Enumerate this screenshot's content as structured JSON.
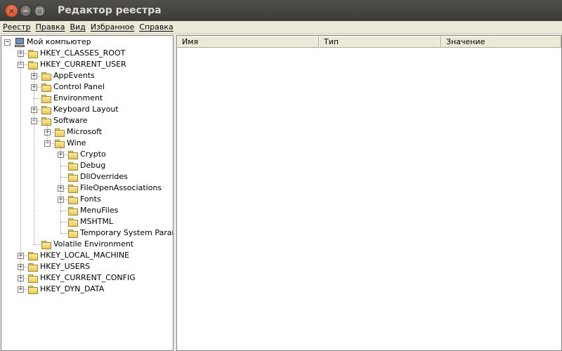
{
  "window": {
    "title": "Редактор реестра",
    "buttons": {
      "close": "×",
      "minimize": "−",
      "maximize": "□"
    }
  },
  "menu": [
    "Реестр",
    "Правка",
    "Вид",
    "Избранное",
    "Справка"
  ],
  "columns": [
    "Имя",
    "Тип",
    "Значение"
  ],
  "tree": [
    {
      "label": "Мой компьютер",
      "depth": 0,
      "expander": "−",
      "icon": "computer-icon"
    },
    {
      "label": "HKEY_CLASSES_ROOT",
      "depth": 1,
      "expander": "+"
    },
    {
      "label": "HKEY_CURRENT_USER",
      "depth": 1,
      "expander": "−"
    },
    {
      "label": "AppEvents",
      "depth": 2,
      "expander": "+"
    },
    {
      "label": "Control Panel",
      "depth": 2,
      "expander": "+"
    },
    {
      "label": "Environment",
      "depth": 2,
      "expander": ""
    },
    {
      "label": "Keyboard Layout",
      "depth": 2,
      "expander": "+"
    },
    {
      "label": "Software",
      "depth": 2,
      "expander": "−"
    },
    {
      "label": "Microsoft",
      "depth": 3,
      "expander": "+"
    },
    {
      "label": "Wine",
      "depth": 3,
      "expander": "−"
    },
    {
      "label": "Crypto",
      "depth": 4,
      "expander": "+"
    },
    {
      "label": "Debug",
      "depth": 4,
      "expander": ""
    },
    {
      "label": "DllOverrides",
      "depth": 4,
      "expander": ""
    },
    {
      "label": "FileOpenAssociations",
      "depth": 4,
      "expander": "+"
    },
    {
      "label": "Fonts",
      "depth": 4,
      "expander": "+"
    },
    {
      "label": "MenuFiles",
      "depth": 4,
      "expander": ""
    },
    {
      "label": "MSHTML",
      "depth": 4,
      "expander": ""
    },
    {
      "label": "Temporary System Paramet",
      "depth": 4,
      "expander": ""
    },
    {
      "label": "Volatile Environment",
      "depth": 2,
      "expander": ""
    },
    {
      "label": "HKEY_LOCAL_MACHINE",
      "depth": 1,
      "expander": "+"
    },
    {
      "label": "HKEY_USERS",
      "depth": 1,
      "expander": "+"
    },
    {
      "label": "HKEY_CURRENT_CONFIG",
      "depth": 1,
      "expander": "+"
    },
    {
      "label": "HKEY_DYN_DATA",
      "depth": 1,
      "expander": "+"
    }
  ]
}
